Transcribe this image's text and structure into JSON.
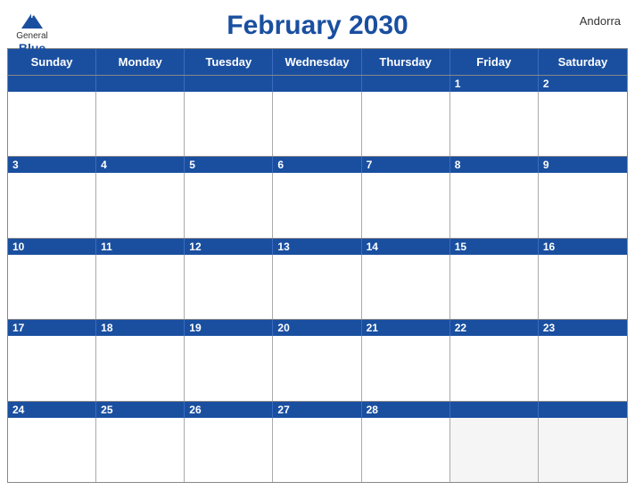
{
  "header": {
    "title": "February 2030",
    "country": "Andorra",
    "logo_general": "General",
    "logo_blue": "Blue"
  },
  "days_of_week": [
    "Sunday",
    "Monday",
    "Tuesday",
    "Wednesday",
    "Thursday",
    "Friday",
    "Saturday"
  ],
  "weeks": [
    {
      "numbers": [
        "",
        "",
        "",
        "",
        "",
        "1",
        "2"
      ],
      "has_days": [
        false,
        false,
        false,
        false,
        false,
        true,
        true
      ]
    },
    {
      "numbers": [
        "3",
        "4",
        "5",
        "6",
        "7",
        "8",
        "9"
      ],
      "has_days": [
        true,
        true,
        true,
        true,
        true,
        true,
        true
      ]
    },
    {
      "numbers": [
        "10",
        "11",
        "12",
        "13",
        "14",
        "15",
        "16"
      ],
      "has_days": [
        true,
        true,
        true,
        true,
        true,
        true,
        true
      ]
    },
    {
      "numbers": [
        "17",
        "18",
        "19",
        "20",
        "21",
        "22",
        "23"
      ],
      "has_days": [
        true,
        true,
        true,
        true,
        true,
        true,
        true
      ]
    },
    {
      "numbers": [
        "24",
        "25",
        "26",
        "27",
        "28",
        "",
        ""
      ],
      "has_days": [
        true,
        true,
        true,
        true,
        true,
        false,
        false
      ]
    }
  ],
  "colors": {
    "blue": "#1a4fa0",
    "light_blue_header": "#2255b0",
    "border": "#aaa"
  }
}
